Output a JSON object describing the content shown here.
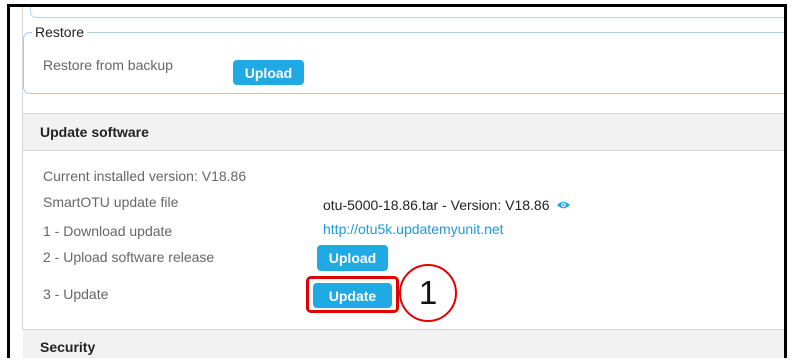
{
  "restore": {
    "legend": "Restore",
    "label": "Restore from backup",
    "upload_label": "Upload"
  },
  "update_software": {
    "title": "Update software",
    "current_version": "Current installed version: V18.86",
    "update_file_label": "SmartOTU update file",
    "update_file_value": "otu-5000-18.86.tar - Version: V18.86",
    "step1_label": "1 - Download update",
    "step1_link": "http://otu5k.updatemyunit.net",
    "step2_label": "2 - Upload software release",
    "step2_button": "Upload",
    "step3_label": "3 - Update",
    "step3_button": "Update"
  },
  "annotation": {
    "callout_number": "1",
    "highlight_color": "#e00000"
  },
  "security": {
    "title": "Security"
  },
  "icons": {
    "view": "eye-icon"
  },
  "colors": {
    "accent": "#1fa9e5",
    "link": "#1e9ad8",
    "section_bg": "#f2f2f2"
  }
}
